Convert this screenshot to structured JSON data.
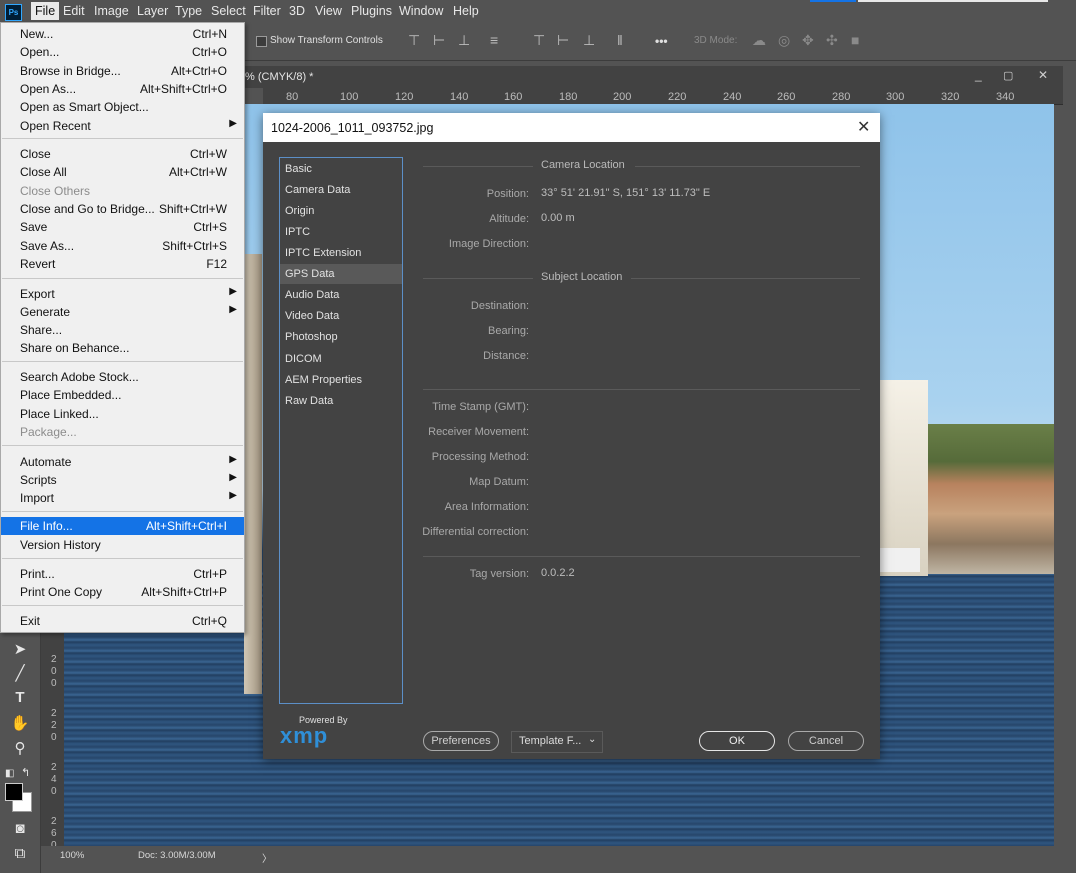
{
  "menubar": {
    "app_logo": "Ps",
    "items": [
      "File",
      "Edit",
      "Image",
      "Layer",
      "Type",
      "Select",
      "Filter",
      "3D",
      "View",
      "Plugins",
      "Window",
      "Help"
    ]
  },
  "options": {
    "transform_label": "Show Transform Controls",
    "more": "•••",
    "mode_3d": "3D Mode:"
  },
  "document": {
    "tab_title": "% (CMYK/8) *",
    "ruler_ticks": [
      "80",
      "100",
      "120",
      "140",
      "160",
      "180",
      "200",
      "220",
      "240",
      "260",
      "280",
      "300",
      "320",
      "340"
    ],
    "left_ruler": [
      "2",
      "0",
      "0",
      "2",
      "2",
      "0",
      "2",
      "4",
      "0",
      "2",
      "6",
      "0"
    ],
    "zoom": "100%",
    "doc_size": "Doc: 3.00M/3.00M"
  },
  "file_menu": {
    "items": [
      {
        "label": "New...",
        "shortcut": "Ctrl+N"
      },
      {
        "label": "Open...",
        "shortcut": "Ctrl+O"
      },
      {
        "label": "Browse in Bridge...",
        "shortcut": "Alt+Ctrl+O"
      },
      {
        "label": "Open As...",
        "shortcut": "Alt+Shift+Ctrl+O"
      },
      {
        "label": "Open as Smart Object...",
        "shortcut": ""
      },
      {
        "label": "Open Recent",
        "shortcut": ""
      },
      {
        "label": "Close",
        "shortcut": "Ctrl+W"
      },
      {
        "label": "Close All",
        "shortcut": "Alt+Ctrl+W"
      },
      {
        "label": "Close Others",
        "shortcut": ""
      },
      {
        "label": "Close and Go to Bridge...",
        "shortcut": "Shift+Ctrl+W"
      },
      {
        "label": "Save",
        "shortcut": "Ctrl+S"
      },
      {
        "label": "Save As...",
        "shortcut": "Shift+Ctrl+S"
      },
      {
        "label": "Revert",
        "shortcut": "F12"
      },
      {
        "label": "Export",
        "shortcut": ""
      },
      {
        "label": "Generate",
        "shortcut": ""
      },
      {
        "label": "Share...",
        "shortcut": ""
      },
      {
        "label": "Share on Behance...",
        "shortcut": ""
      },
      {
        "label": "Search Adobe Stock...",
        "shortcut": ""
      },
      {
        "label": "Place Embedded...",
        "shortcut": ""
      },
      {
        "label": "Place Linked...",
        "shortcut": ""
      },
      {
        "label": "Package...",
        "shortcut": ""
      },
      {
        "label": "Automate",
        "shortcut": ""
      },
      {
        "label": "Scripts",
        "shortcut": ""
      },
      {
        "label": "Import",
        "shortcut": ""
      },
      {
        "label": "File Info...",
        "shortcut": "Alt+Shift+Ctrl+I"
      },
      {
        "label": "Version History",
        "shortcut": ""
      },
      {
        "label": "Print...",
        "shortcut": "Ctrl+P"
      },
      {
        "label": "Print One Copy",
        "shortcut": "Alt+Shift+Ctrl+P"
      },
      {
        "label": "Exit",
        "shortcut": "Ctrl+Q"
      }
    ]
  },
  "dialog": {
    "title": "1024-2006_1011_093752.jpg",
    "close": "✕",
    "nav": [
      "Basic",
      "Camera Data",
      "Origin",
      "IPTC",
      "IPTC Extension",
      "GPS Data",
      "Audio Data",
      "Video Data",
      "Photoshop",
      "DICOM",
      "AEM Properties",
      "Raw Data"
    ],
    "selected_nav": "GPS Data",
    "camera_location_header": "Camera Location",
    "position_label": "Position:",
    "position_value": "33° 51' 21.91\" S,  151° 13' 11.73\" E",
    "altitude_label": "Altitude:",
    "altitude_value": "0.00 m",
    "image_direction_label": "Image Direction:",
    "subject_location_header": "Subject Location",
    "destination_label": "Destination:",
    "bearing_label": "Bearing:",
    "distance_label": "Distance:",
    "timestamp_label": "Time Stamp (GMT):",
    "receiver_label": "Receiver Movement:",
    "processing_label": "Processing Method:",
    "map_datum_label": "Map Datum:",
    "area_label": "Area Information:",
    "differential_label": "Differential correction:",
    "tag_version_label": "Tag version:",
    "tag_version_value": "0.0.2.2",
    "powered_by": "Powered By",
    "xmp_logo": "xmp",
    "preferences": "Preferences",
    "template": "Template F...",
    "ok": "OK",
    "cancel": "Cancel"
  },
  "colors": {
    "accent": "#1473e6",
    "selection_blue": "#1473e6",
    "dialog_bg": "#434343"
  }
}
